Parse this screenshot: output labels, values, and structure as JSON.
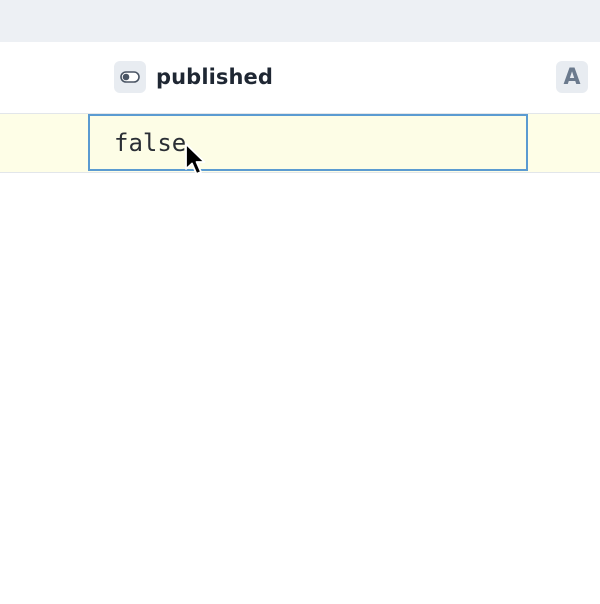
{
  "table": {
    "columns": [
      {
        "title": "published",
        "type_icon": "toggle-icon"
      },
      {
        "title": "",
        "type_icon": "text-type-icon",
        "type_glyph": "A"
      }
    ],
    "rows": [
      {
        "published": "false"
      }
    ]
  },
  "cursor": {
    "type": "arrow-pointer"
  },
  "colors": {
    "toolbar_bg": "#edf0f4",
    "row_highlight": "#fefee7",
    "focus_border": "#5b9bd1",
    "text": "#1f2733"
  }
}
